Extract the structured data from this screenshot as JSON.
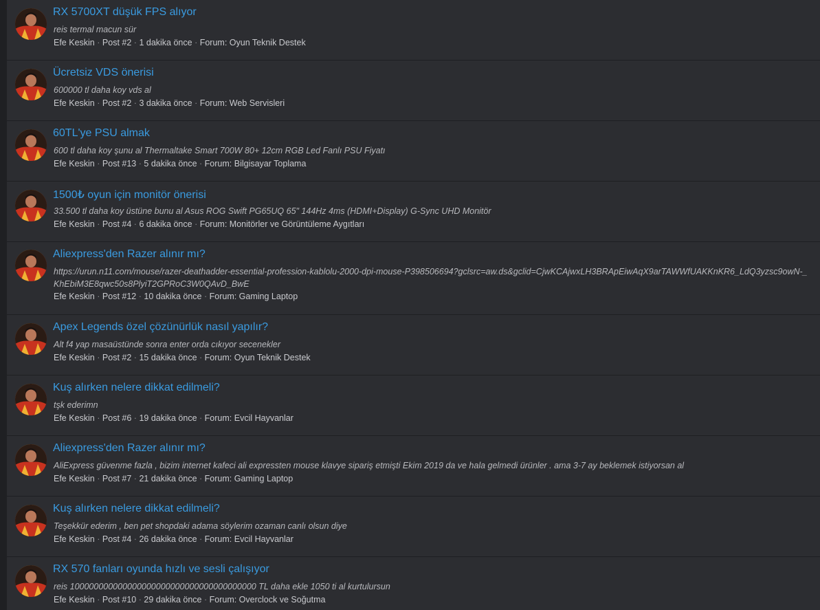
{
  "results": [
    {
      "title": "RX 5700XT düşük FPS alıyor",
      "snippet": "reis termal macun sür",
      "author": "Efe Keskin",
      "post": "Post #2",
      "time": "1 dakika önce",
      "forum": "Forum: Oyun Teknik Destek"
    },
    {
      "title": "Ücretsiz VDS önerisi",
      "snippet": "600000 tl daha koy vds al",
      "author": "Efe Keskin",
      "post": "Post #2",
      "time": "3 dakika önce",
      "forum": "Forum: Web Servisleri"
    },
    {
      "title": "60TL'ye PSU almak",
      "snippet": "600 tl daha koy şunu al Thermaltake Smart 700W 80+ 12cm RGB Led Fanlı PSU Fiyatı",
      "author": "Efe Keskin",
      "post": "Post #13",
      "time": "5 dakika önce",
      "forum": "Forum: Bilgisayar Toplama"
    },
    {
      "title": "1500₺ oyun için monitör önerisi",
      "snippet": "33.500 tl daha koy üstüne bunu al Asus ROG Swift PG65UQ 65\" 144Hz 4ms (HDMI+Display) G-Sync UHD Monitör",
      "author": "Efe Keskin",
      "post": "Post #4",
      "time": "6 dakika önce",
      "forum": "Forum: Monitörler ve Görüntüleme Aygıtları"
    },
    {
      "title": "Aliexpress'den Razer alınır mı?",
      "snippet": "https://urun.n11.com/mouse/razer-deathadder-essential-profession-kablolu-2000-dpi-mouse-P398506694?gclsrc=aw.ds&gclid=CjwKCAjwxLH3BRApEiwAqX9arTAWWfUAKKnKR6_LdQ3yzsc9owN-_KhEbiM3E8qwc50s8PlyiT2GPRoC3W0QAvD_BwE",
      "author": "Efe Keskin",
      "post": "Post #12",
      "time": "10 dakika önce",
      "forum": "Forum: Gaming Laptop"
    },
    {
      "title": "Apex Legends özel çözünürlük nasıl yapılır?",
      "snippet": "Alt f4 yap masaüstünde sonra enter orda cıkıyor secenekler",
      "author": "Efe Keskin",
      "post": "Post #2",
      "time": "15 dakika önce",
      "forum": "Forum: Oyun Teknik Destek"
    },
    {
      "title": "Kuş alırken nelere dikkat edilmeli?",
      "snippet": "tşk ederimn",
      "author": "Efe Keskin",
      "post": "Post #6",
      "time": "19 dakika önce",
      "forum": "Forum: Evcil Hayvanlar"
    },
    {
      "title": "Aliexpress'den Razer alınır mı?",
      "snippet": "AliExpress güvenme fazla , bizim internet kafeci ali expressten mouse klavye sipariş etmişti Ekim 2019 da ve hala gelmedi ürünler . ama 3-7 ay beklemek istiyorsan al",
      "author": "Efe Keskin",
      "post": "Post #7",
      "time": "21 dakika önce",
      "forum": "Forum: Gaming Laptop"
    },
    {
      "title": "Kuş alırken nelere dikkat edilmeli?",
      "snippet": "Teşekkür ederim , ben pet shopdaki adama söylerim ozaman canlı olsun diye",
      "author": "Efe Keskin",
      "post": "Post #4",
      "time": "26 dakika önce",
      "forum": "Forum: Evcil Hayvanlar"
    },
    {
      "title": "RX 570 fanları oyunda hızlı ve sesli çalışıyor",
      "snippet": "reis 100000000000000000000000000000000000000 TL daha ekle 1050 ti al kurtulursun",
      "author": "Efe Keskin",
      "post": "Post #10",
      "time": "29 dakika önce",
      "forum": "Forum: Overclock ve Soğutma"
    }
  ],
  "separator": "·"
}
